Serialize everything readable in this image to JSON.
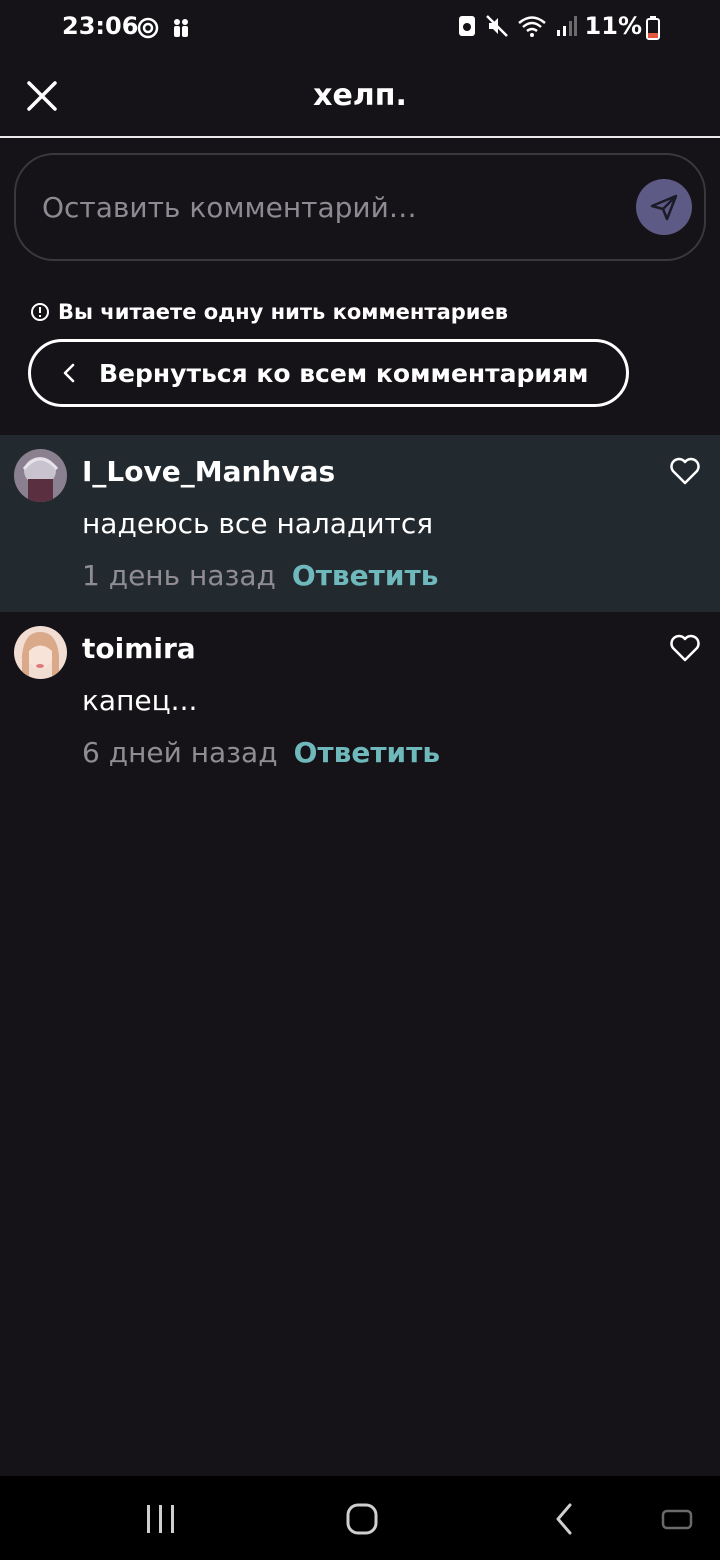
{
  "status_bar": {
    "time": "23:06",
    "battery_percent": "11%",
    "battery_level": 0.11
  },
  "header": {
    "title": "хелп.",
    "close_icon": "close-icon"
  },
  "comment_input": {
    "placeholder": "Оставить комментарий…",
    "send_icon": "send-icon",
    "send_color": "#5d5a86"
  },
  "thread": {
    "notice": "Вы читаете одну нить комментариев",
    "back_label": "Вернуться ко всем комментариям"
  },
  "comments": [
    {
      "username": "I_Love_Manhvas",
      "text": "надеюсь все наладится",
      "time": "1 день назад",
      "reply_label": "Ответить",
      "highlighted": true
    },
    {
      "username": "toimira",
      "text": "капец...",
      "time": "6 дней назад",
      "reply_label": "Ответить",
      "highlighted": false
    }
  ],
  "colors": {
    "background": "#151317",
    "highlight": "#232a2f",
    "accent": "#6fb9bc",
    "muted": "#8f8d92"
  }
}
